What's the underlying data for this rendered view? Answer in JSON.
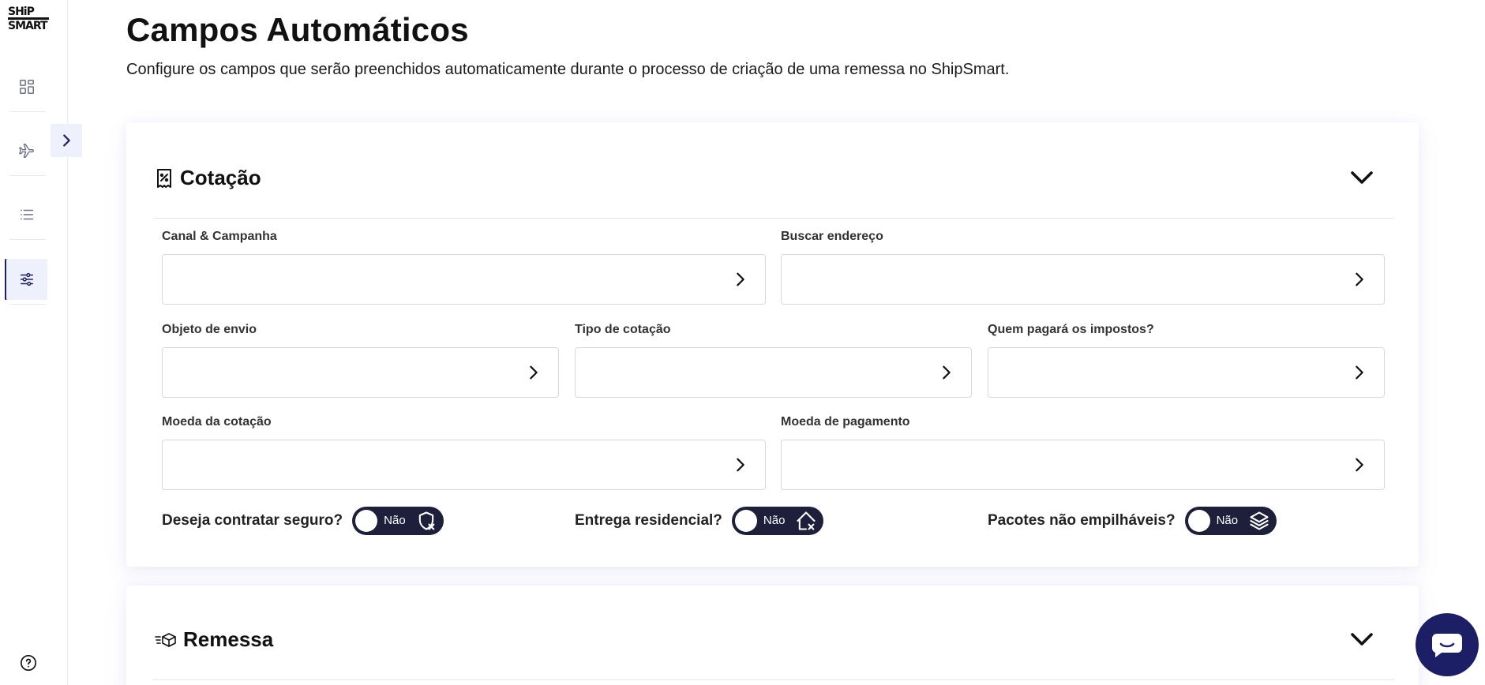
{
  "brand": {
    "logo_line1": "SHiP",
    "logo_line2": "SMART"
  },
  "page": {
    "title": "Campos Automáticos",
    "subtitle": "Configure os campos que serão preenchidos automaticamente durante o processo de criação de uma remessa no ShipSmart."
  },
  "sidebar": {
    "items": [
      {
        "icon": "dashboard-icon",
        "active": false
      },
      {
        "icon": "airplane-icon",
        "active": false
      },
      {
        "icon": "list-icon",
        "active": false
      },
      {
        "icon": "sliders-icon",
        "active": true
      }
    ],
    "help_icon": "help-icon"
  },
  "sections": {
    "cotacao": {
      "title": "Cotação",
      "fields": {
        "canal": {
          "label": "Canal & Campanha",
          "value": ""
        },
        "buscar": {
          "label": "Buscar endereço",
          "value": ""
        },
        "objeto": {
          "label": "Objeto de envio",
          "value": ""
        },
        "tipo": {
          "label": "Tipo de cotação",
          "value": ""
        },
        "impostos": {
          "label": "Quem pagará os impostos?",
          "value": ""
        },
        "moeda_cot": {
          "label": "Moeda da cotação",
          "value": ""
        },
        "moeda_pag": {
          "label": "Moeda de pagamento",
          "value": ""
        }
      },
      "toggles": {
        "seguro": {
          "label": "Deseja contratar seguro?",
          "value": "Não",
          "on": false
        },
        "residencial": {
          "label": "Entrega residencial?",
          "value": "Não",
          "on": false
        },
        "empilhaveis": {
          "label": "Pacotes não empilháveis?",
          "value": "Não",
          "on": false
        }
      }
    },
    "remessa": {
      "title": "Remessa"
    }
  },
  "colors": {
    "primary": "#1d1f66",
    "toggle_bg": "#1d1f3b",
    "active_bg": "#eef0fb"
  }
}
